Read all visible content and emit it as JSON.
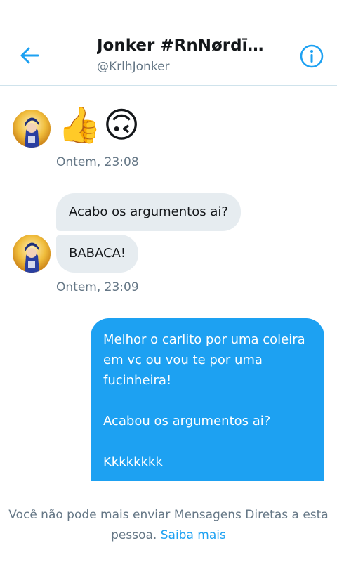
{
  "header": {
    "title": "Jonker #RnNørdīčø...",
    "handle": "@KrlhJonker",
    "back_icon": "arrow-left-icon",
    "info_icon": "info-icon",
    "accent": "#1da1f2"
  },
  "messages": {
    "group1": {
      "emoji1": "👍",
      "emoji2": "🙃",
      "timestamp": "Ontem, 23:08"
    },
    "group2": {
      "bubble1": "Acabo os argumentos ai?",
      "bubble2": "BABACA!",
      "timestamp": "Ontem, 23:09"
    },
    "outgoing": {
      "line1": "Melhor o carlito por uma coleira",
      "line2": "em vc ou vou te por uma",
      "line3": "fucinheira!",
      "line4": "Acabou os argumentos ai?",
      "line5": "Kkkkkkkk"
    }
  },
  "footer": {
    "notice": "Você não pode mais enviar Mensagens Diretas a esta pessoa.",
    "link": "Saiba mais"
  }
}
